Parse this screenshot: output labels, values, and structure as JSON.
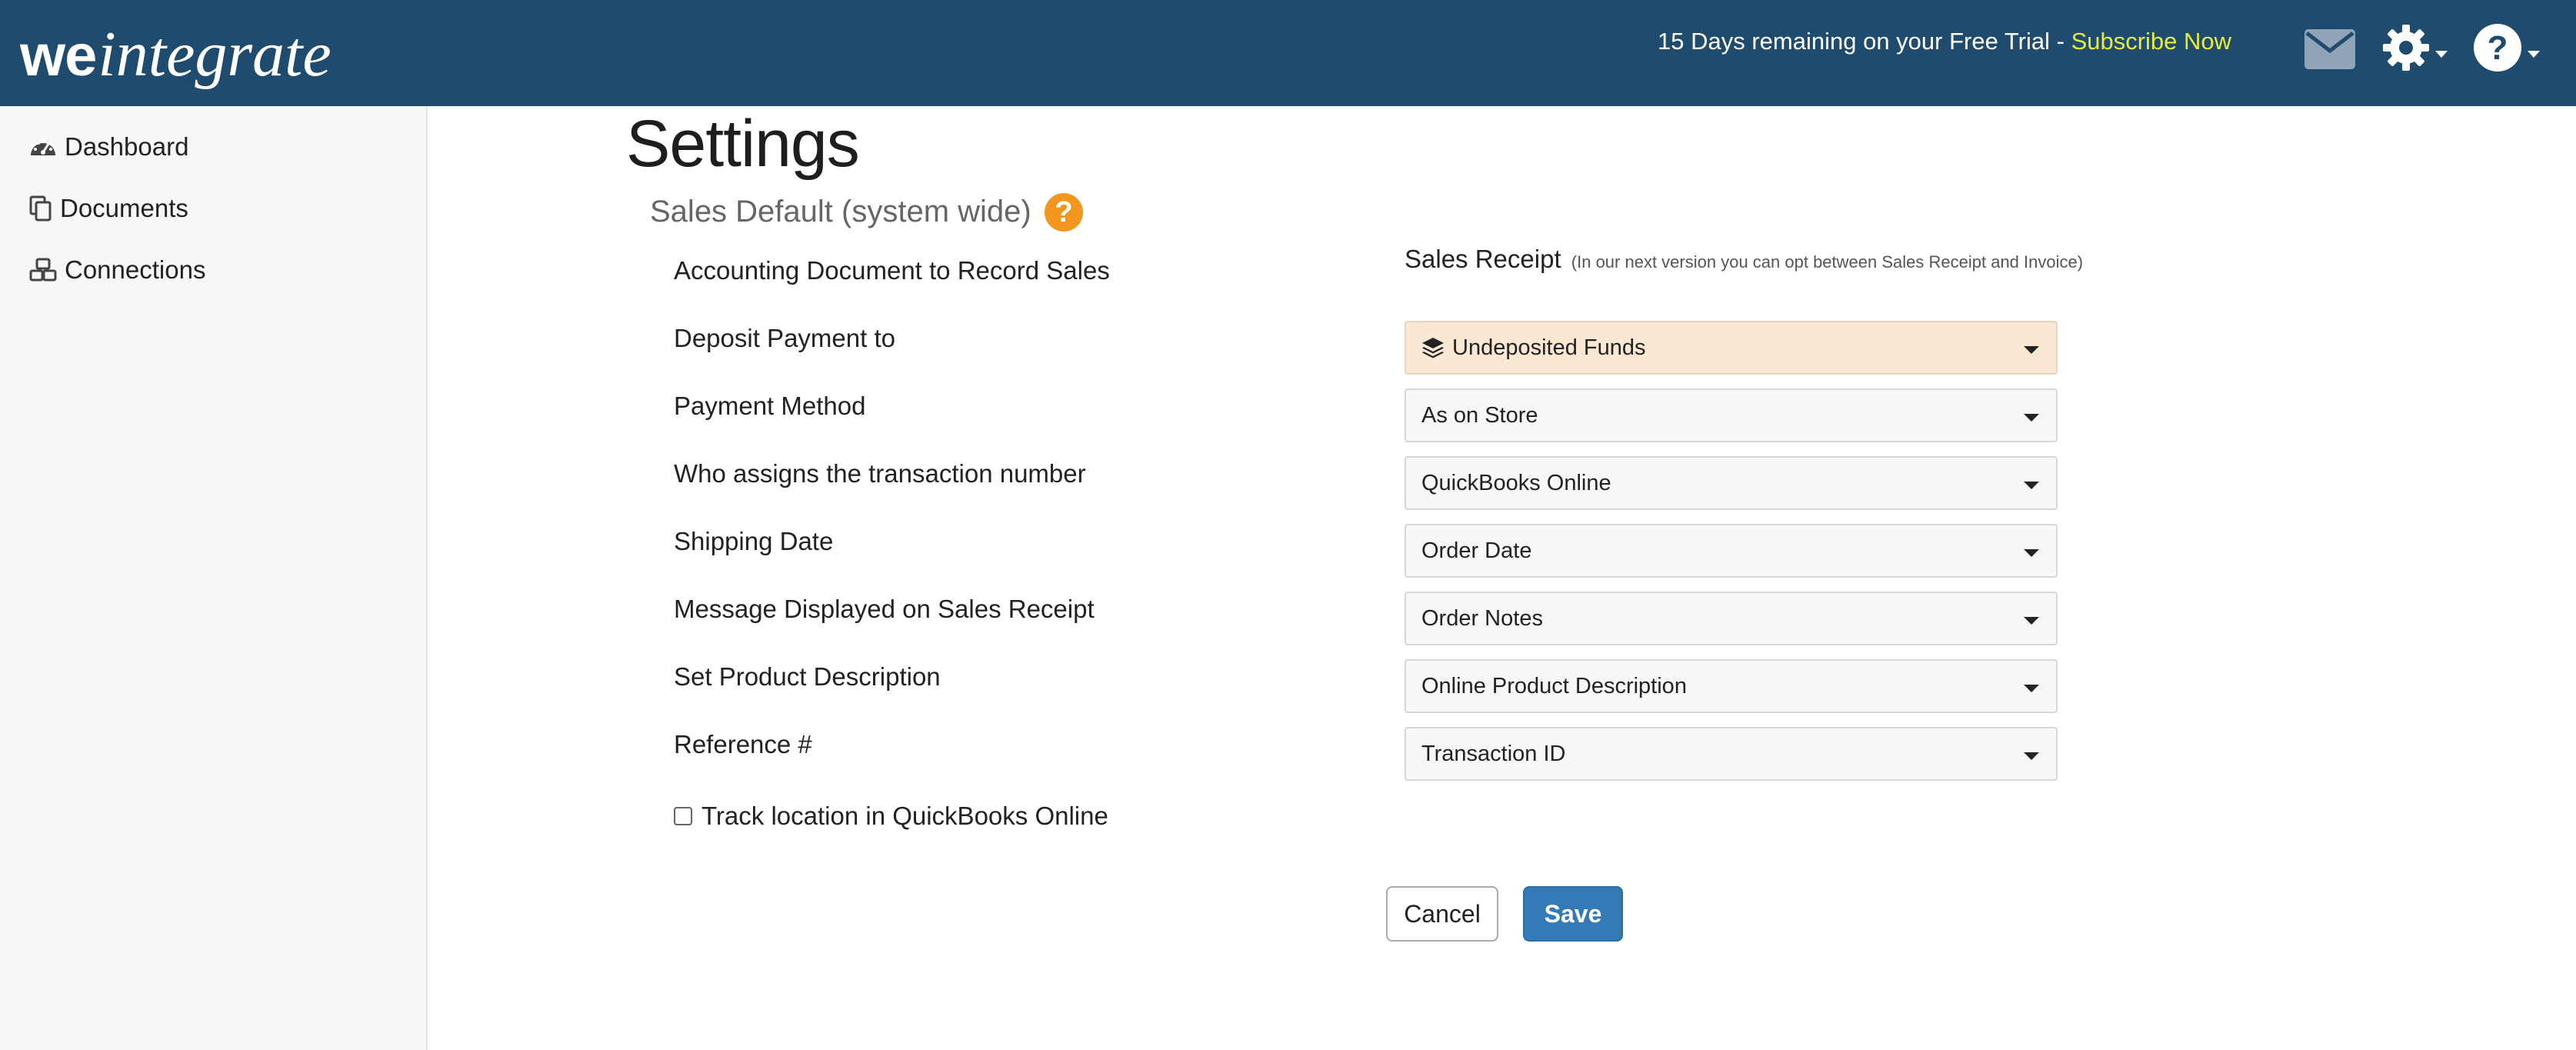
{
  "header": {
    "logo_we": "we",
    "logo_integrate": "integrate",
    "trial_text": "15 Days remaining on your Free Trial - ",
    "subscribe_link": "Subscribe Now",
    "icons": [
      "envelope-icon",
      "gear-icon",
      "help-icon"
    ]
  },
  "sidebar": {
    "items": [
      {
        "label": "Dashboard",
        "icon": "dashboard-icon"
      },
      {
        "label": "Documents",
        "icon": "documents-icon"
      },
      {
        "label": "Connections",
        "icon": "connections-icon"
      }
    ]
  },
  "page": {
    "title": "Settings",
    "section_title": "Sales Default (system wide)",
    "help_glyph": "?"
  },
  "settings": {
    "labels": [
      "Accounting Document to Record Sales",
      "Deposit Payment to",
      "Payment Method",
      "Who assigns the transaction number",
      "Shipping Date",
      "Message Displayed on Sales Receipt",
      "Set Product Description",
      "Reference #"
    ],
    "accounting_document": "Sales Receipt",
    "accounting_document_note": "(In our next version you can opt between Sales Receipt and Invoice)",
    "selects": [
      "Undeposited Funds",
      "As on Store",
      "QuickBooks Online",
      "Order Date",
      "Order Notes",
      "Online Product Description",
      "Transaction ID"
    ],
    "track_location_label": "Track location in QuickBooks Online",
    "track_location_checked": false
  },
  "buttons": {
    "cancel": "Cancel",
    "save": "Save"
  },
  "colors": {
    "header_bg": "#1f4b6e",
    "subscribe": "#e7ec3b",
    "help_badge": "#f3961f",
    "highlight_select": "#fbe8d2",
    "primary": "#337ab7"
  }
}
